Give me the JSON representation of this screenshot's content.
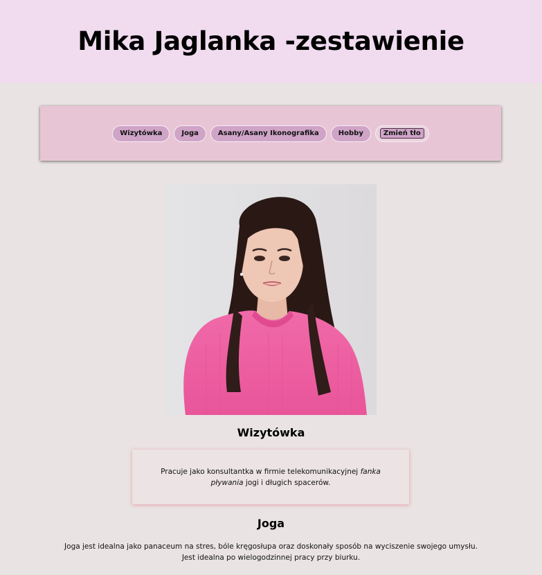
{
  "header": {
    "title": "Mika Jaglanka -zestawienie"
  },
  "nav": {
    "items": [
      {
        "label": "Wizytówka"
      },
      {
        "label": "Joga"
      },
      {
        "label": "Asany/Asany Ikonografika"
      },
      {
        "label": "Hobby"
      }
    ],
    "change_bg_label": "Zmień tło"
  },
  "sections": {
    "wizytowka": {
      "title": "Wizytówka",
      "text_before": "Pracuje jako konsultantka w firmie telekomunikacyjnej ",
      "text_italic": "fanka pływania",
      "text_after": " jogi i długich spacerów."
    },
    "joga": {
      "title": "Joga",
      "line1": "Joga jest idealna jako panaceum na stres, bóle kręgosłupa oraz doskonały sposób na wyciszenie swojego umysłu.",
      "line2": "Jest idealna po wielogodzinnej pracy przy biurku."
    }
  },
  "colors": {
    "header_bg": "#f0dbef",
    "page_bg": "#e9e3e3",
    "nav_bg": "#e8c5d5",
    "button_bg": "#cfa4c7"
  }
}
